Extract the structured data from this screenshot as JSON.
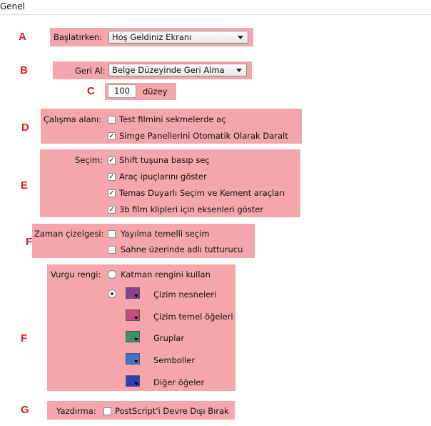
{
  "page": {
    "title": "Genel"
  },
  "letters": {
    "a": "A",
    "b": "B",
    "c": "C",
    "d": "D",
    "e": "E",
    "f1": "F",
    "f2": "F",
    "g": "G"
  },
  "startup": {
    "label": "Başlatırken:",
    "value": "Hoş Geldiniz Ekranı"
  },
  "undo": {
    "label": "Geri Al:",
    "value": "Belge Düzeyinde Geri Alma",
    "levels_value": "100",
    "levels_unit": "düzey"
  },
  "workspace": {
    "label": "Çalışma alanı:",
    "options": [
      {
        "label": "Test filmini sekmelerde aç",
        "checked": false
      },
      {
        "label": "Simge Panellerini Otomatik Olarak Daralt",
        "checked": true
      }
    ]
  },
  "selection": {
    "label": "Seçim:",
    "options": [
      {
        "label": "Shift tuşuna basıp seç",
        "checked": true
      },
      {
        "label": "Araç ipuçlarını göster",
        "checked": true
      },
      {
        "label": "Temas Duyarlı Seçim ve Kement araçları",
        "checked": true
      },
      {
        "label": "3b film klipleri için eksenleri göster",
        "checked": true
      }
    ]
  },
  "timeline": {
    "label": "Zaman çizelgesi:",
    "options": [
      {
        "label": "Yayılma temelli seçim",
        "checked": false
      },
      {
        "label": "Sahne üzerinde adlı tutturucu",
        "checked": false
      }
    ]
  },
  "highlight": {
    "label": "Vurgu rengi:",
    "layer_color_label": "Katman rengini kullan",
    "layer_color_selected": false,
    "custom_selected": true,
    "items": [
      {
        "label": "Çizim nesneleri",
        "color": "#8b3f8f"
      },
      {
        "label": "Çizim temel öğeleri",
        "color": "#c84a7d"
      },
      {
        "label": "Gruplar",
        "color": "#3f8f6b"
      },
      {
        "label": "Semboller",
        "color": "#3f74c8"
      },
      {
        "label": "Diğer öğeler",
        "color": "#2f3fb8"
      }
    ]
  },
  "printing": {
    "label": "Yazdırma:",
    "option": "PostScript'i Devre Dışı Bırak",
    "checked": false
  },
  "colors": {
    "highlight": "#f4a6ac",
    "letter": "#e51b1b"
  }
}
